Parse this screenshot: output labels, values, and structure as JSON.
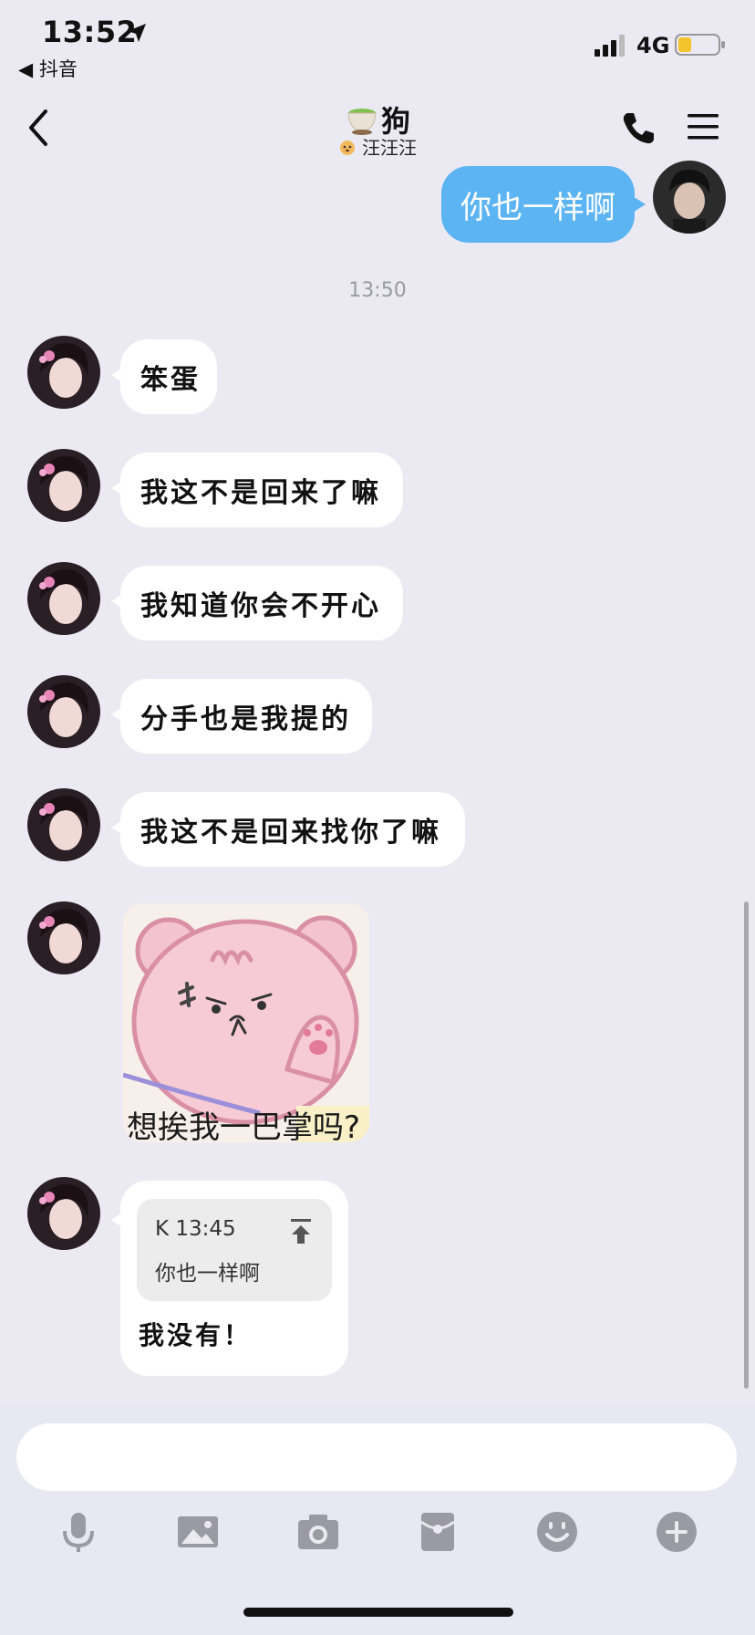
{
  "status_bar": {
    "time": "13:52",
    "back_app": "◀ 抖音",
    "network": "4G"
  },
  "nav": {
    "title": "狗",
    "subtitle": "汪汪汪",
    "back": "back",
    "call": "phone",
    "menu": "menu"
  },
  "chat": {
    "sent_message": "你也一样啊",
    "timestamp": "13:50",
    "received": [
      "笨蛋",
      "我这不是回来了嘛",
      "我知道你会不开心",
      "分手也是我提的",
      "我这不是回来找你了嘛"
    ],
    "sticker_caption": "想挨我一巴掌吗?",
    "quote": {
      "header": "K 13:45",
      "text": "你也一样啊"
    },
    "reply": "我没有！"
  },
  "input": {
    "placeholder": ""
  },
  "toolbar": [
    "microphone-icon",
    "image-icon",
    "camera-icon",
    "redpacket-icon",
    "emoji-icon",
    "plus-icon"
  ],
  "colors": {
    "accent": "#5cb4f3",
    "background": "#ebeaf3",
    "bubble": "#ffffff"
  }
}
